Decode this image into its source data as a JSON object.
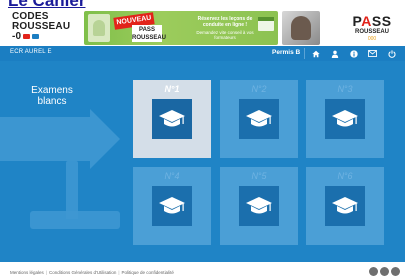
{
  "top_heading": "Le Cahier",
  "header": {
    "logo": {
      "line1": "CODES",
      "line2": "ROUSSEAU",
      "line3": "-0"
    },
    "banner": {
      "badge": "NOUVEAU",
      "product": "PASS ROUSSEAU",
      "text1": "Réservez les leçons de conduite en ligne !",
      "text2": "Demandez vite conseil à vos formateurs"
    },
    "pass_logo": {
      "line1_a": "P",
      "line1_b": "A",
      "line1_c": "SS",
      "line2": "ROUSSEAU",
      "line3": "000"
    }
  },
  "nav": {
    "left_text": "ECR AUREL E",
    "permis_label": "Permis B",
    "icons": [
      "home-icon",
      "user-icon",
      "info-icon",
      "mail-icon",
      "power-icon"
    ]
  },
  "main": {
    "title": "Examens blancs",
    "tiles": [
      {
        "label": "N°1",
        "selected": true
      },
      {
        "label": "N°2",
        "selected": false
      },
      {
        "label": "N°3",
        "selected": false
      },
      {
        "label": "N°4",
        "selected": false
      },
      {
        "label": "N°5",
        "selected": false
      },
      {
        "label": "N°6",
        "selected": false
      }
    ]
  },
  "footer": {
    "links": [
      "Mentions légales",
      "Conditions Générales d'Utilisation",
      "Politique de confidentialité"
    ],
    "icons": [
      "social-icon-1",
      "social-icon-2",
      "social-icon-3"
    ]
  },
  "colors": {
    "nav_blue": "#1b7ec2",
    "main_blue": "#1f84c6",
    "tile_blue": "#4b9fd6",
    "tile_selected": "#d4dee8",
    "tile_inner": "#1b6fad"
  }
}
